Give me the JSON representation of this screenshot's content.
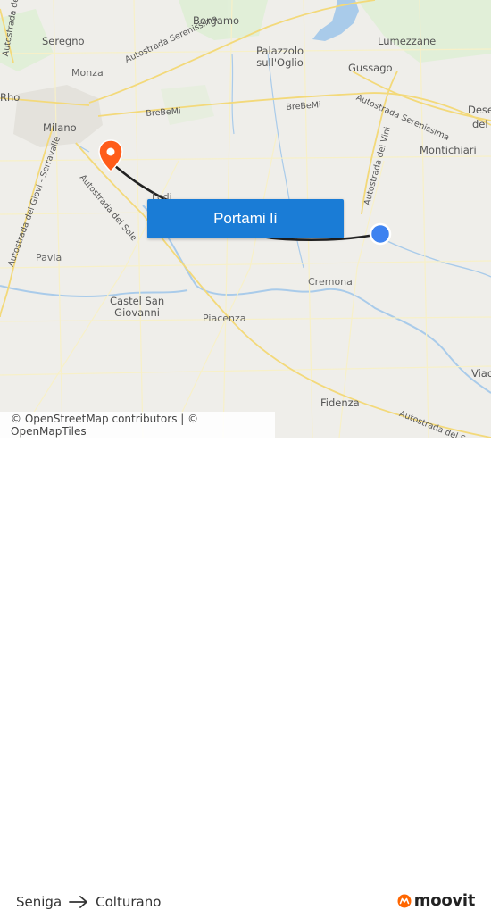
{
  "map": {
    "places": {
      "seregno": "Seregno",
      "bergamo": "Bergamo",
      "palazzolo": "Palazzolo\nsull'Oglio",
      "lumezzane": "Lumezzane",
      "gussago": "Gussago",
      "monza": "Monza",
      "rho": "Rho",
      "milano": "Milano",
      "montichiari": "Montichiari",
      "dese": "Dese",
      "del": "del",
      "lodi": "Lodi",
      "pavia": "Pavia",
      "castel_san_giovanni": "Castel San\nGiovanni",
      "piacenza": "Piacenza",
      "cremona": "Cremona",
      "fidenza": "Fidenza",
      "viad": "Viad"
    },
    "roads": {
      "serenissima_1": "Autostrada Serenissima",
      "serenissima_2": "Autostrada Serenissima",
      "brebemi_1": "BreBeMi",
      "brebemi_2": "BreBeMi",
      "del_sole_1": "Autostrada del Sole",
      "del_sole_2": "Autostrada del Sol",
      "dei_vini": "Autostrada dei Vini",
      "giovi_serravalle": "Autostrada dei Giovi - Serravalle",
      "lagi": "Autostrada dei Lagi"
    },
    "colors": {
      "route": "#222222",
      "origin_marker": "#3d82f0",
      "destination_marker": "#ff5c1a",
      "water": "#a9cbea",
      "park": "#cfe6c4"
    }
  },
  "cta": {
    "label": "Portami lì"
  },
  "attribution": {
    "text": "© OpenStreetMap contributors | © OpenMapTiles"
  },
  "footer": {
    "origin": "Seniga",
    "destination": "Colturano",
    "brand": "moovit",
    "brand_color": "#ff6600"
  },
  "icons": {
    "origin_marker": "blue-dot-icon",
    "destination_marker": "map-pin-icon",
    "route_arrow": "arrow-right-icon",
    "brand_logo": "moovit-logo-icon"
  }
}
